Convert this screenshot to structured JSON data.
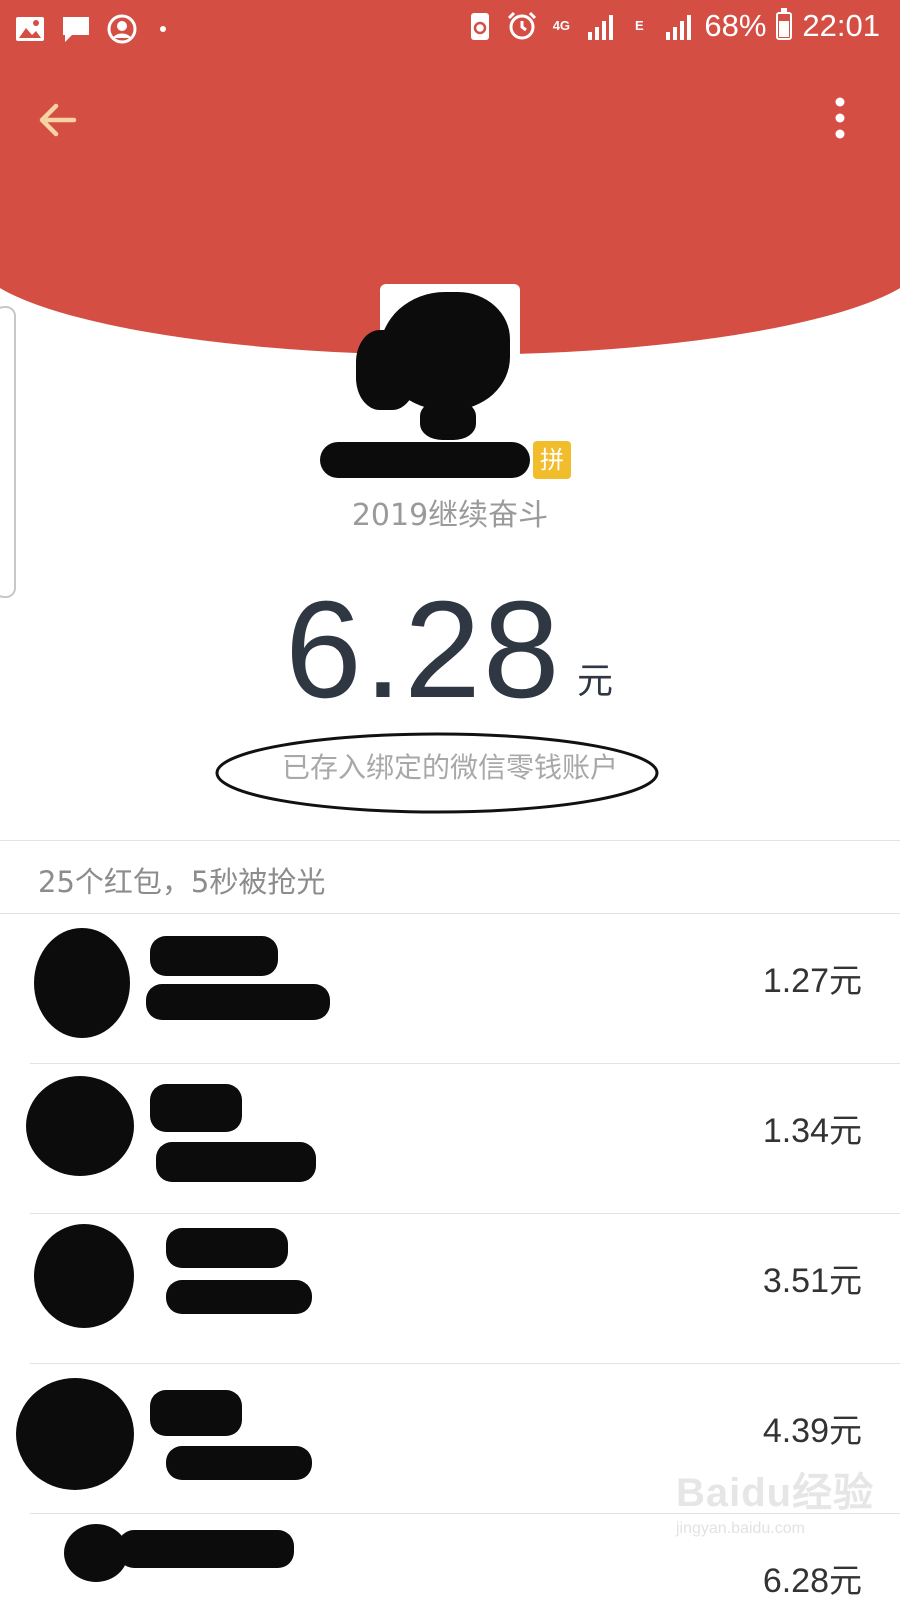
{
  "status_bar": {
    "network_top": "4G",
    "network_second": "E",
    "battery": "68%",
    "time": "22:01",
    "icons_left": [
      "gallery-icon",
      "message-icon",
      "account-icon"
    ],
    "icons_right": [
      "recycle-icon",
      "alarm-icon",
      "signal-icon",
      "battery-icon"
    ]
  },
  "nav": {
    "back_icon": "back-arrow-icon",
    "more_icon": "more-vertical-icon",
    "icon_color": "#f7d2a3"
  },
  "sender": {
    "badge": "拼",
    "greeting": "2019继续奋斗"
  },
  "amount": {
    "value": "6.28",
    "unit": "元",
    "note": "已存入绑定的微信零钱账户"
  },
  "summary": "25个红包，5秒被抢光",
  "receivers": [
    {
      "amount": "1.27",
      "unit": "元"
    },
    {
      "amount": "1.34",
      "unit": "元"
    },
    {
      "amount": "3.51",
      "unit": "元"
    },
    {
      "amount": "4.39",
      "unit": "元"
    },
    {
      "amount": "6.28",
      "unit": "元"
    }
  ],
  "watermark": {
    "logo": "Baidu经验",
    "url": "jingyan.baidu.com"
  },
  "colors": {
    "header_red": "#d44e44",
    "badge_yellow": "#f2bd2c",
    "amount_text": "#2f3742"
  }
}
